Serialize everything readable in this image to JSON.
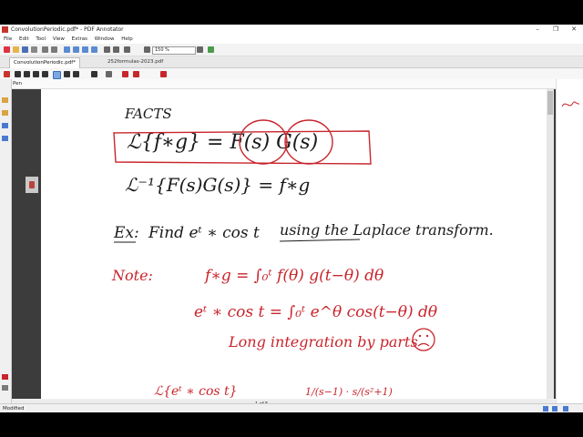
{
  "window": {
    "title": "ConvolutionPeriodic.pdf* - PDF Annotator",
    "minimize": "–",
    "restore": "❐",
    "close": "✕"
  },
  "menu": [
    "File",
    "Edit",
    "Tool",
    "View",
    "Extras",
    "Window",
    "Help"
  ],
  "toolbar": {
    "zoom": "150 %"
  },
  "tabs": [
    {
      "label": "ConvolutionPeriodic.pdf*"
    },
    {
      "label": "252formulas-2023.pdf"
    }
  ],
  "pen_bar": {
    "label": "Pen"
  },
  "status": {
    "text": "Modified",
    "pager": "1 of 5"
  },
  "colors": {
    "ink_black": "#1a1a1a",
    "ink_red": "#c8252c",
    "app_red": "#c8352c"
  },
  "notes": {
    "facts": "FACTS",
    "laplace_conv": "ℒ{f∗g} = F(s) G(s)",
    "inverse": "ℒ⁻¹{F(s)G(s)} = f∗g",
    "ex_label": "Ex:",
    "ex_text": "Find   eᵗ ∗ cos t",
    "ex_method": "using the Laplace transform.",
    "note_label": "Note:",
    "def1": "f∗g =  ∫₀ᵗ f(θ) g(t−θ) dθ",
    "def2": "eᵗ ∗ cos t =  ∫₀ᵗ e^θ cos(t−θ) dθ",
    "long": "Long integration by parts",
    "bottom_left": "ℒ{eᵗ ∗ cos t}",
    "bottom_right": "1/(s−1) · s/(s²+1)"
  }
}
